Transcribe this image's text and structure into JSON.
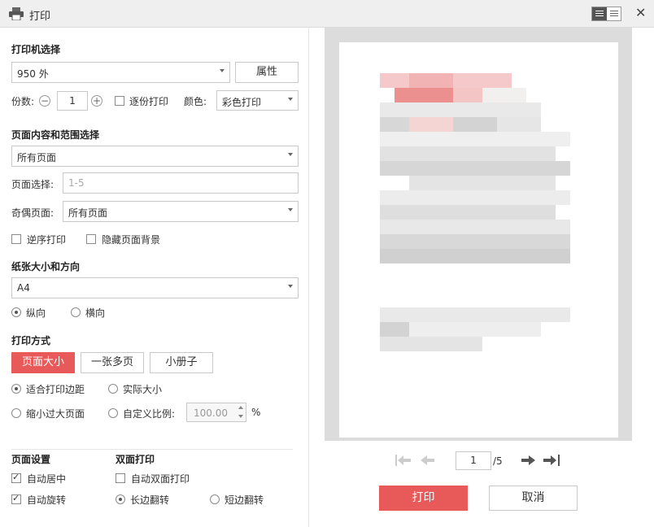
{
  "window": {
    "title": "打印"
  },
  "printer": {
    "section": "打印机选择",
    "selected": "950 外",
    "properties_button": "属性",
    "copies_label": "份数:",
    "copies_value": "1",
    "collate_label": "逐份打印",
    "color_label": "颜色:",
    "color_value": "彩色打印"
  },
  "range": {
    "section": "页面内容和范围选择",
    "content_value": "所有页面",
    "page_select_label": "页面选择:",
    "page_select_placeholder": "1-5",
    "odd_even_label": "奇偶页面:",
    "odd_even_value": "所有页面",
    "reverse_label": "逆序打印",
    "hide_bg_label": "隐藏页面背景"
  },
  "paper": {
    "section": "纸张大小和方向",
    "size_value": "A4",
    "portrait_label": "纵向",
    "landscape_label": "横向"
  },
  "mode": {
    "section": "打印方式",
    "tabs": [
      "页面大小",
      "一张多页",
      "小册子"
    ],
    "fit_margin_label": "适合打印边距",
    "actual_size_label": "实际大小",
    "shrink_label": "缩小过大页面",
    "custom_scale_label": "自定义比例:",
    "custom_scale_value": "100.00",
    "percent": "%"
  },
  "page_setup": {
    "section": "页面设置",
    "auto_center_label": "自动居中",
    "auto_rotate_label": "自动旋转"
  },
  "duplex": {
    "section": "双面打印",
    "auto_duplex_label": "自动双面打印",
    "long_edge_label": "长边翻转",
    "short_edge_label": "短边翻转"
  },
  "preview": {
    "current_page": "1",
    "total_pages": "/5"
  },
  "actions": {
    "print_label": "打印",
    "cancel_label": "取消"
  },
  "colors": {
    "accent": "#e85a59"
  }
}
